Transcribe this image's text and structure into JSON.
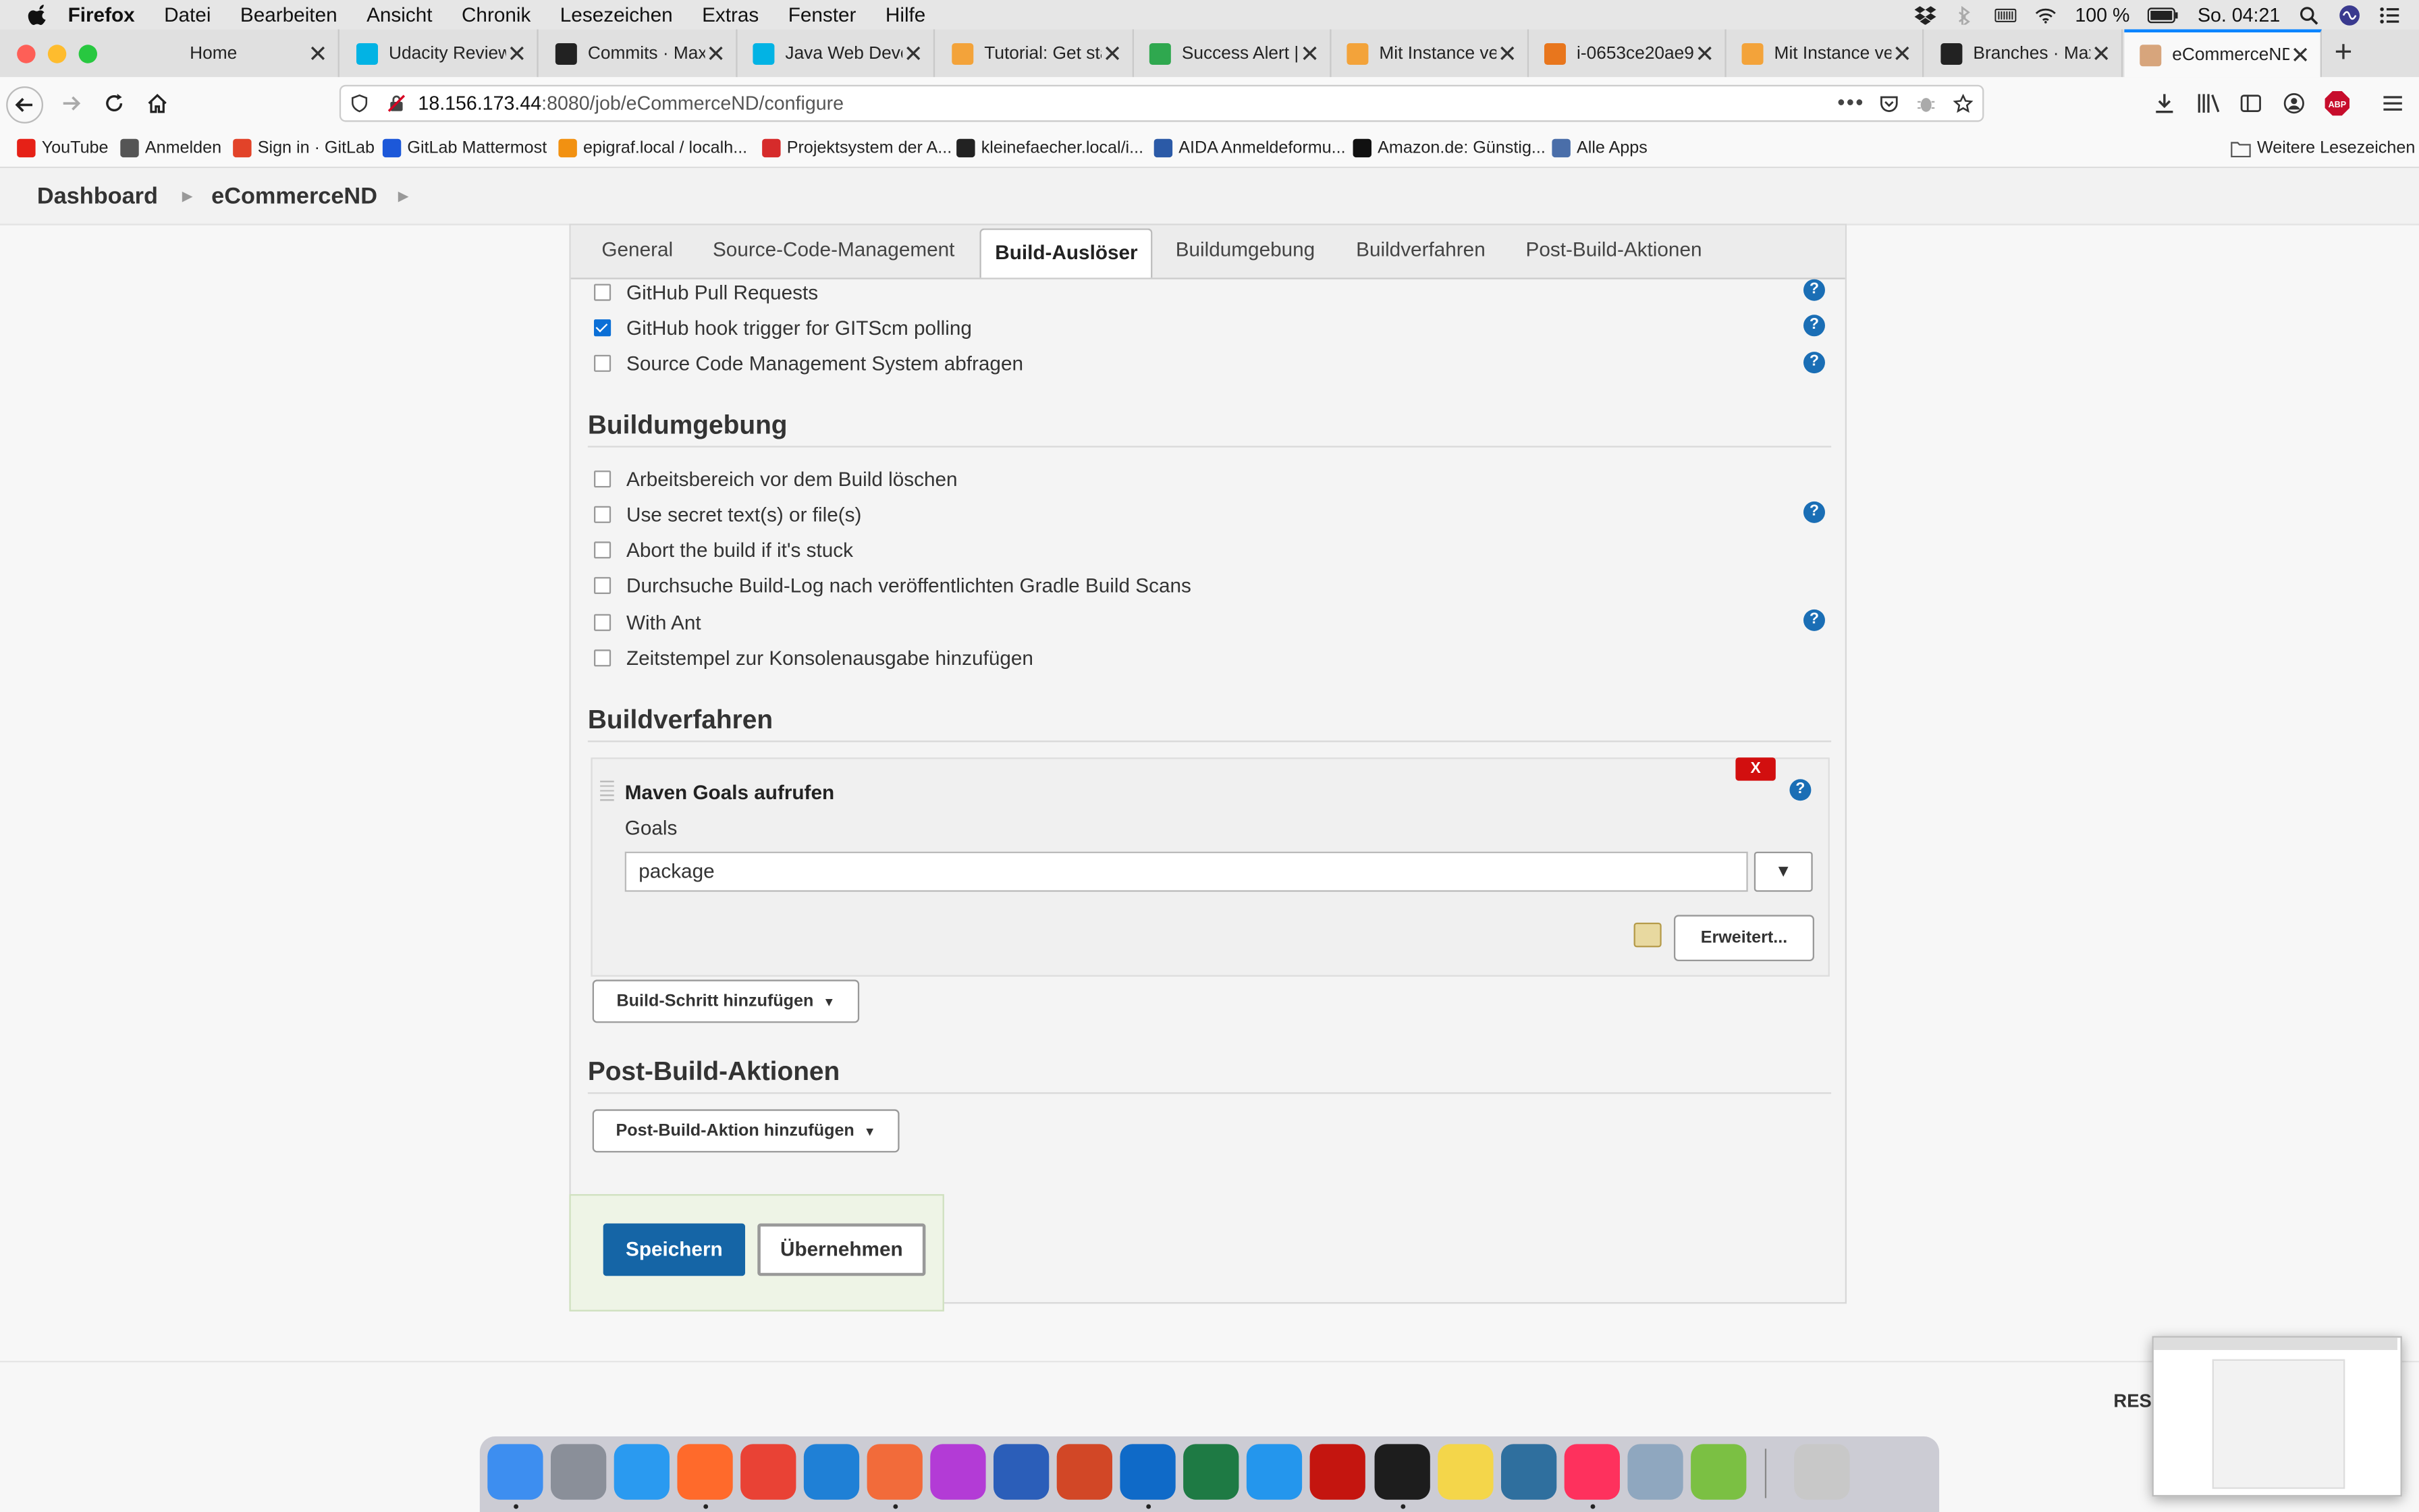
{
  "menubar": {
    "app": "Firefox",
    "items": [
      "Datei",
      "Bearbeiten",
      "Ansicht",
      "Chronik",
      "Lesezeichen",
      "Extras",
      "Fenster",
      "Hilfe"
    ],
    "battery": "100 %",
    "clock": "So. 04:21"
  },
  "tabs": [
    {
      "title": "Home",
      "icon": "generic-icon",
      "color": "#e0e0e0"
    },
    {
      "title": "Udacity Reviews",
      "icon": "udacity-icon",
      "color": "#02b3e4"
    },
    {
      "title": "Commits · Maxim",
      "icon": "github-icon",
      "color": "#222222"
    },
    {
      "title": "Java Web Develo",
      "icon": "udacity-icon",
      "color": "#02b3e4"
    },
    {
      "title": "Tutorial: Get sta",
      "icon": "aws-icon",
      "color": "#f3a33a"
    },
    {
      "title": "Success Alert | S",
      "icon": "terminal-icon",
      "color": "#2fa84f"
    },
    {
      "title": "Mit Instance ver",
      "icon": "aws-icon",
      "color": "#f3a33a"
    },
    {
      "title": "i-0653ce20ae9",
      "icon": "aws-icon",
      "color": "#e8761d"
    },
    {
      "title": "Mit Instance ver",
      "icon": "aws-icon",
      "color": "#f3a33a"
    },
    {
      "title": "Branches · Maxi",
      "icon": "github-icon",
      "color": "#222222"
    },
    {
      "title": "eCommerceND C",
      "icon": "jenkins-icon",
      "color": "#d7a57c"
    }
  ],
  "url": {
    "host": "18.156.173.44",
    "path": ":8080/job/eCommerceND/configure"
  },
  "bookmarks": [
    {
      "label": "YouTube",
      "color": "#e62117"
    },
    {
      "label": "Anmelden",
      "color": "#555555"
    },
    {
      "label": "Sign in · GitLab",
      "color": "#e24329"
    },
    {
      "label": "GitLab Mattermost",
      "color": "#1c58d9"
    },
    {
      "label": "epigraf.local / localh...",
      "color": "#f29111"
    },
    {
      "label": "Projektsystem der A...",
      "color": "#d62b2b"
    },
    {
      "label": "kleinefaecher.local/i...",
      "color": "#222222"
    },
    {
      "label": "AIDA Anmeldeformu...",
      "color": "#2b5aa7"
    },
    {
      "label": "Amazon.de: Günstig...",
      "color": "#111111"
    },
    {
      "label": "Alle Apps",
      "color": "#4a6ea9"
    }
  ],
  "bookmarks_more": "Weitere Lesezeichen",
  "breadcrumb": {
    "items": [
      "Dashboard",
      "eCommerceND"
    ]
  },
  "config_tabs": [
    "General",
    "Source-Code-Management",
    "Build-Auslöser",
    "Buildumgebung",
    "Buildverfahren",
    "Post-Build-Aktionen"
  ],
  "active_tab": "Build-Auslöser",
  "triggers": [
    {
      "label": "GitHub Pull Requests",
      "checked": false,
      "help": true
    },
    {
      "label": "GitHub hook trigger for GITScm polling",
      "checked": true,
      "help": true
    },
    {
      "label": "Source Code Management System abfragen",
      "checked": false,
      "help": true
    }
  ],
  "build_env": {
    "title": "Buildumgebung",
    "options": [
      {
        "label": "Arbeitsbereich vor dem Build löschen",
        "checked": false,
        "help": false
      },
      {
        "label": "Use secret text(s) or file(s)",
        "checked": false,
        "help": true
      },
      {
        "label": "Abort the build if it's stuck",
        "checked": false,
        "help": false
      },
      {
        "label": "Durchsuche Build-Log nach veröffentlichten Gradle Build Scans",
        "checked": false,
        "help": false
      },
      {
        "label": "With Ant",
        "checked": false,
        "help": true
      },
      {
        "label": "Zeitstempel zur Konsolenausgabe hinzufügen",
        "checked": false,
        "help": false
      }
    ]
  },
  "build_steps": {
    "title": "Buildverfahren",
    "step_title": "Maven Goals aufrufen",
    "delete_label": "X",
    "goals_label": "Goals",
    "goals_value": "package",
    "dropdown_glyph": "▼",
    "advanced_label": "Erweitert...",
    "add_label": "Build-Schritt hinzufügen"
  },
  "post_build": {
    "title": "Post-Build-Aktionen",
    "add_label": "Post-Build-Aktion hinzufügen"
  },
  "actions": {
    "save": "Speichern",
    "apply": "Übernehmen"
  },
  "footer": {
    "rest": "RES"
  },
  "dock": [
    {
      "icon": "finder-icon",
      "color": "#3d8ef0",
      "running": true
    },
    {
      "icon": "launchpad-icon",
      "color": "#8a8f99",
      "running": false
    },
    {
      "icon": "safari-icon",
      "color": "#2a9af0",
      "running": false
    },
    {
      "icon": "firefox-icon",
      "color": "#ff6a2b",
      "running": true
    },
    {
      "icon": "chrome-icon",
      "color": "#e94235",
      "running": false
    },
    {
      "icon": "vscode-icon",
      "color": "#1f80d6",
      "running": false
    },
    {
      "icon": "postman-icon",
      "color": "#f26b3a",
      "running": true
    },
    {
      "icon": "phpstorm-icon",
      "color": "#b33bd6",
      "running": false
    },
    {
      "icon": "word-icon",
      "color": "#2b5eb9",
      "running": false
    },
    {
      "icon": "powerpoint-icon",
      "color": "#d24726",
      "running": false
    },
    {
      "icon": "outlook-icon",
      "color": "#0f6ac8",
      "running": true
    },
    {
      "icon": "excel-icon",
      "color": "#1e7a44",
      "running": false
    },
    {
      "icon": "docker-icon",
      "color": "#2496ed",
      "running": false
    },
    {
      "icon": "acrobat-icon",
      "color": "#c4150f",
      "running": false
    },
    {
      "icon": "terminal-icon",
      "color": "#1d1d1d",
      "running": true
    },
    {
      "icon": "notes-icon",
      "color": "#f4d64a",
      "running": false
    },
    {
      "icon": "mysql-workbench-icon",
      "color": "#2f6f9e",
      "running": false
    },
    {
      "icon": "intellij-icon",
      "color": "#fe315d",
      "running": true
    },
    {
      "icon": "preview-icon",
      "color": "#8fa7bf",
      "running": false
    },
    {
      "icon": "shell-launcher-icon",
      "color": "#7bc043",
      "running": false
    },
    {
      "icon": "trash-icon",
      "color": "#c8c8c8",
      "running": false
    }
  ]
}
